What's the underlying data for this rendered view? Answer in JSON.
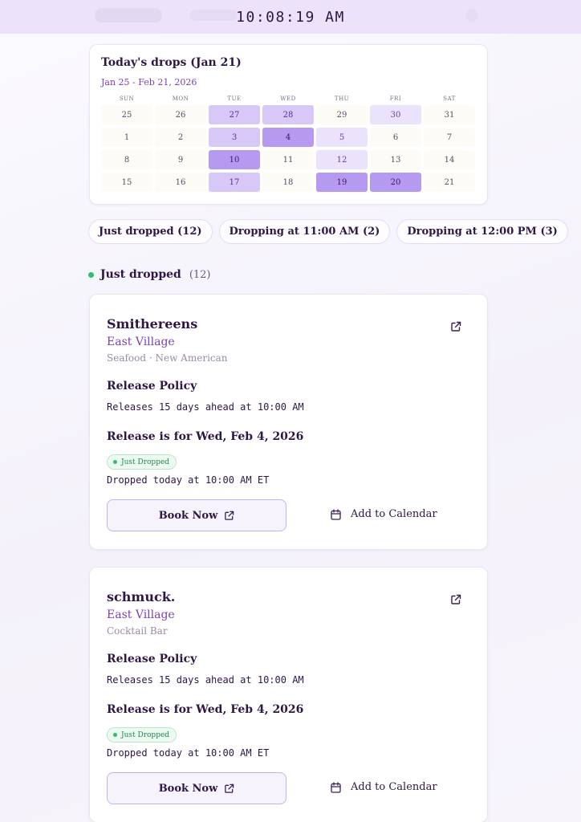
{
  "header": {
    "clock": "10:08:19 AM"
  },
  "calendar": {
    "title": "Today's drops (Jan 21)",
    "range": "Jan 25 - Feb 21, 2026",
    "weekdays": [
      "SUN",
      "MON",
      "TUE",
      "WED",
      "THU",
      "FRI",
      "SAT"
    ],
    "days": [
      {
        "d": "25",
        "level": 0
      },
      {
        "d": "26",
        "level": 0
      },
      {
        "d": "27",
        "level": 2
      },
      {
        "d": "28",
        "level": 2
      },
      {
        "d": "29",
        "level": 0
      },
      {
        "d": "30",
        "level": 1
      },
      {
        "d": "31",
        "level": 0
      },
      {
        "d": "1",
        "level": 0
      },
      {
        "d": "2",
        "level": 0
      },
      {
        "d": "3",
        "level": 2
      },
      {
        "d": "4",
        "level": 3
      },
      {
        "d": "5",
        "level": 1
      },
      {
        "d": "6",
        "level": 0
      },
      {
        "d": "7",
        "level": 0
      },
      {
        "d": "8",
        "level": 0
      },
      {
        "d": "9",
        "level": 0
      },
      {
        "d": "10",
        "level": 3
      },
      {
        "d": "11",
        "level": 0
      },
      {
        "d": "12",
        "level": 1
      },
      {
        "d": "13",
        "level": 0
      },
      {
        "d": "14",
        "level": 0
      },
      {
        "d": "15",
        "level": 0
      },
      {
        "d": "16",
        "level": 0
      },
      {
        "d": "17",
        "level": 2
      },
      {
        "d": "18",
        "level": 0
      },
      {
        "d": "19",
        "level": 3
      },
      {
        "d": "20",
        "level": 3
      },
      {
        "d": "21",
        "level": 0
      }
    ]
  },
  "filters": [
    "Just dropped (12)",
    "Dropping at 11:00 AM (2)",
    "Dropping at 12:00 PM (3)"
  ],
  "section": {
    "title": "Just dropped",
    "count": "(12)"
  },
  "colors": {
    "accent": "#7b3fb0",
    "status_green": "#27c26b",
    "heading": "#2e1745"
  },
  "cards": [
    {
      "name": "Smithereens",
      "neighborhood": "East Village",
      "cuisine": "Seafood · New American",
      "policy_heading": "Release Policy",
      "policy_text": "Releases 15 days ahead at 10:00 AM",
      "release_heading": "Release is for Wed, Feb 4, 2026",
      "badge": "Just Dropped",
      "dropped_text": "Dropped today at 10:00 AM ET",
      "book_label": "Book Now",
      "calendar_label": "Add to Calendar"
    },
    {
      "name": "schmuck.",
      "neighborhood": "East Village",
      "cuisine": "Cocktail Bar",
      "policy_heading": "Release Policy",
      "policy_text": "Releases 15 days ahead at 10:00 AM",
      "release_heading": "Release is for Wed, Feb 4, 2026",
      "badge": "Just Dropped",
      "dropped_text": "Dropped today at 10:00 AM ET",
      "book_label": "Book Now",
      "calendar_label": "Add to Calendar"
    }
  ]
}
